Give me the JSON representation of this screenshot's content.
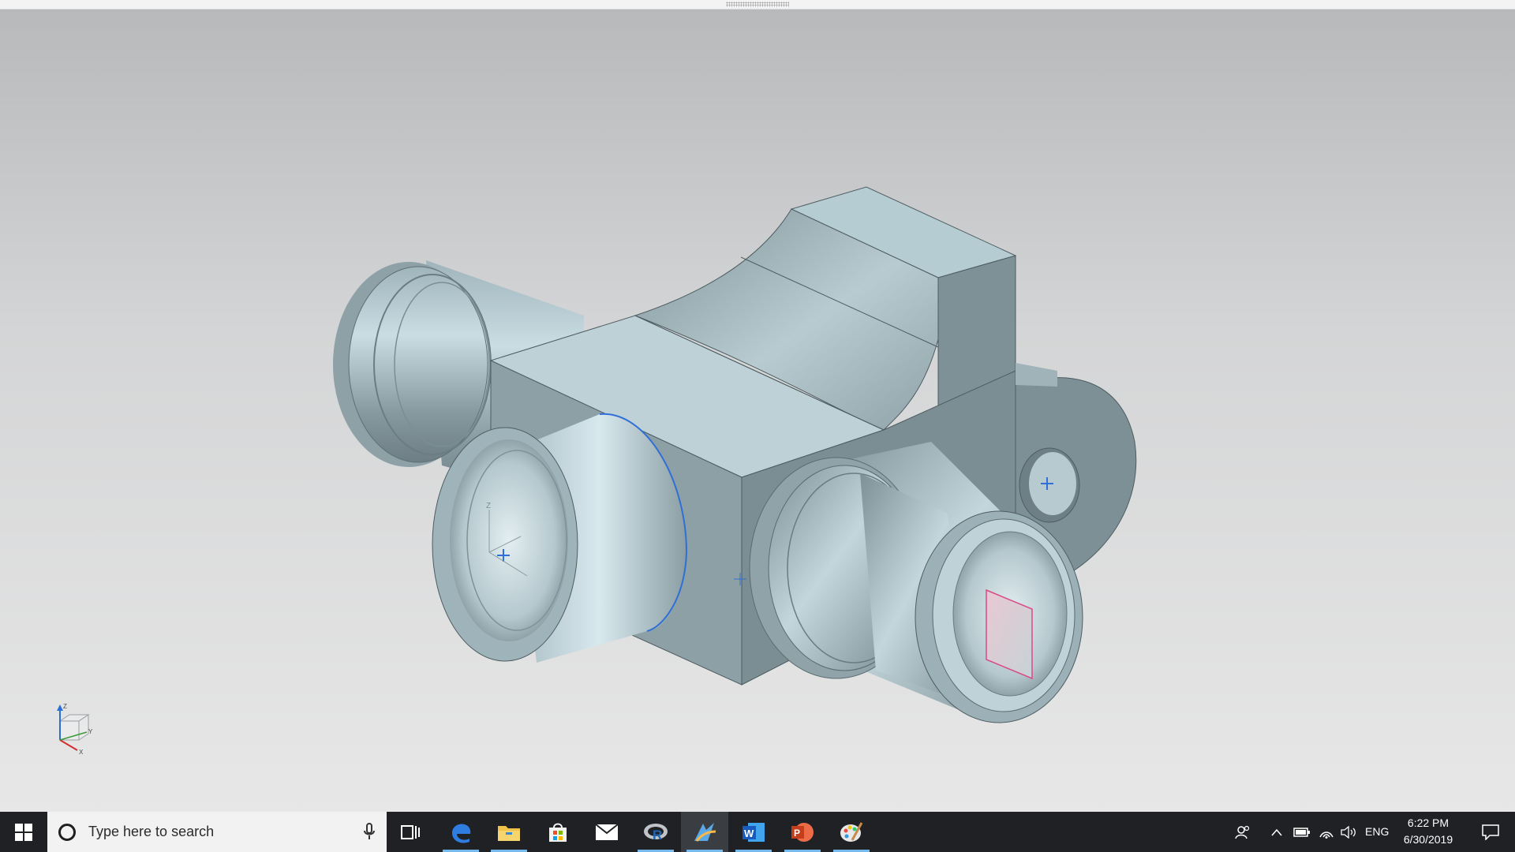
{
  "window": {
    "top_strip": "drag-handle"
  },
  "viewport": {
    "model": "3D solid part: body with cylindrical bosses and mounting flange",
    "triad_axes": [
      "Z",
      "Y",
      "X"
    ],
    "part_csys_axes": [
      "Z",
      "X",
      "Y"
    ]
  },
  "taskbar": {
    "search": {
      "placeholder": "Type here to search"
    },
    "apps": [
      {
        "name": "task-view",
        "icon": "task-view-icon"
      },
      {
        "name": "edge",
        "icon": "edge-icon",
        "running": true
      },
      {
        "name": "file-explorer",
        "icon": "folder-icon",
        "running": true
      },
      {
        "name": "store",
        "icon": "store-icon"
      },
      {
        "name": "mail",
        "icon": "mail-icon"
      },
      {
        "name": "r",
        "icon": "r-icon",
        "running": true
      },
      {
        "name": "nx",
        "icon": "nx-icon",
        "running": true,
        "active": true
      },
      {
        "name": "word",
        "icon": "word-icon",
        "running": true
      },
      {
        "name": "powerpoint",
        "icon": "powerpoint-icon",
        "running": true
      },
      {
        "name": "paint",
        "icon": "paint-icon",
        "running": true
      }
    ],
    "tray": {
      "language": "ENG",
      "time": "6:22 PM",
      "date": "6/30/2019"
    },
    "colors": {
      "accent_underline": "#76b9ed",
      "background": "#1f2125"
    }
  }
}
